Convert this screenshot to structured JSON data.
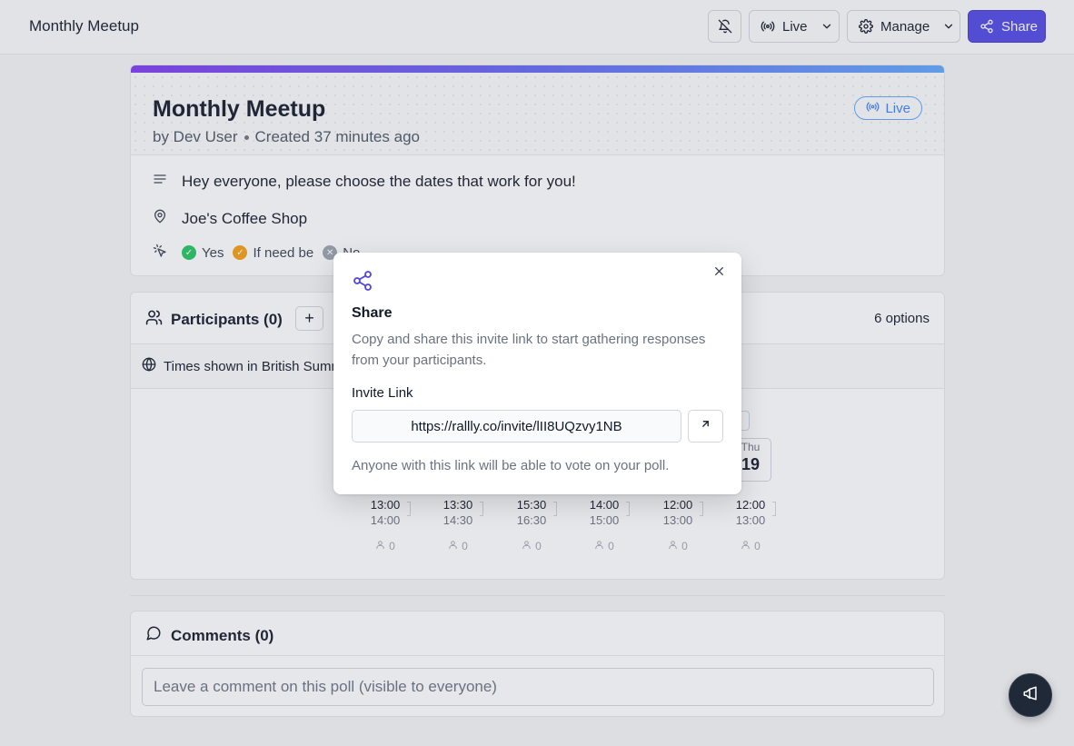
{
  "app": {
    "title": "Monthly Meetup"
  },
  "toolbar": {
    "live_label": "Live",
    "manage_label": "Manage",
    "share_label": "Share"
  },
  "poll": {
    "title": "Monthly Meetup",
    "author": "by Dev User",
    "created": "Created 37 minutes ago",
    "status_badge": "Live",
    "description": "Hey everyone, please choose the dates that work for you!",
    "location": "Joe's Coffee Shop",
    "legend": {
      "yes": "Yes",
      "if_need_be": "If need be",
      "no": "No"
    }
  },
  "participants": {
    "title": "Participants (0)",
    "options_count": "6 options",
    "timezone_text": "Times shown in British Summer Time",
    "visible_date": {
      "dow": "Thu",
      "day": "19"
    },
    "time_slots": [
      {
        "start": "13:00",
        "end": "14:00",
        "count": "0"
      },
      {
        "start": "13:30",
        "end": "14:30",
        "count": "0"
      },
      {
        "start": "15:30",
        "end": "16:30",
        "count": "0"
      },
      {
        "start": "14:00",
        "end": "15:00",
        "count": "0"
      },
      {
        "start": "12:00",
        "end": "13:00",
        "count": "0"
      },
      {
        "start": "12:00",
        "end": "13:00",
        "count": "0"
      }
    ]
  },
  "comments": {
    "title": "Comments (0)",
    "placeholder": "Leave a comment on this poll (visible to everyone)"
  },
  "share_modal": {
    "title": "Share",
    "description": "Copy and share this invite link to start gathering responses from your participants.",
    "invite_label": "Invite Link",
    "invite_url": "https://rallly.co/invite/lII8UQzvy1NB",
    "note": "Anyone with this link will be able to vote on your poll."
  },
  "colors": {
    "accent": "#4f46e5",
    "yes": "#22c55e",
    "if_need_be": "#f59e0b",
    "no": "#9ca3af"
  }
}
